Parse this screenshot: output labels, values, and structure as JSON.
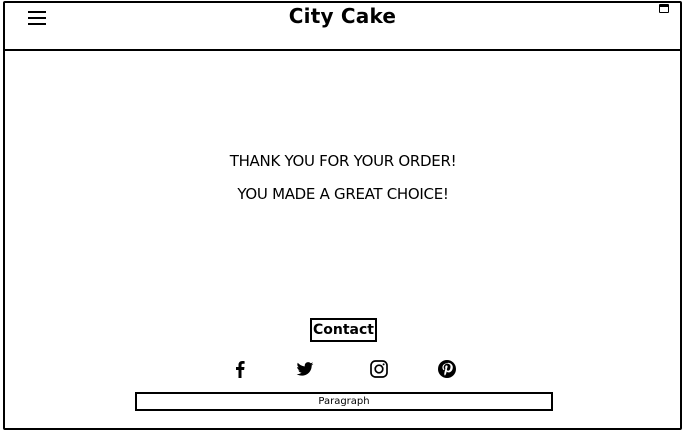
{
  "header": {
    "title": "City Cake",
    "menu_icon": "hamburger-menu-icon",
    "window_icon": "window-icon"
  },
  "main": {
    "message_line1": "THANK YOU FOR YOUR ORDER!",
    "message_line2": "YOU MADE A GREAT CHOICE!"
  },
  "footer": {
    "contact_label": "Contact",
    "social_icons": [
      "facebook-icon",
      "twitter-icon",
      "instagram-icon",
      "pinterest-icon"
    ],
    "paragraph_text": "Paragraph"
  }
}
